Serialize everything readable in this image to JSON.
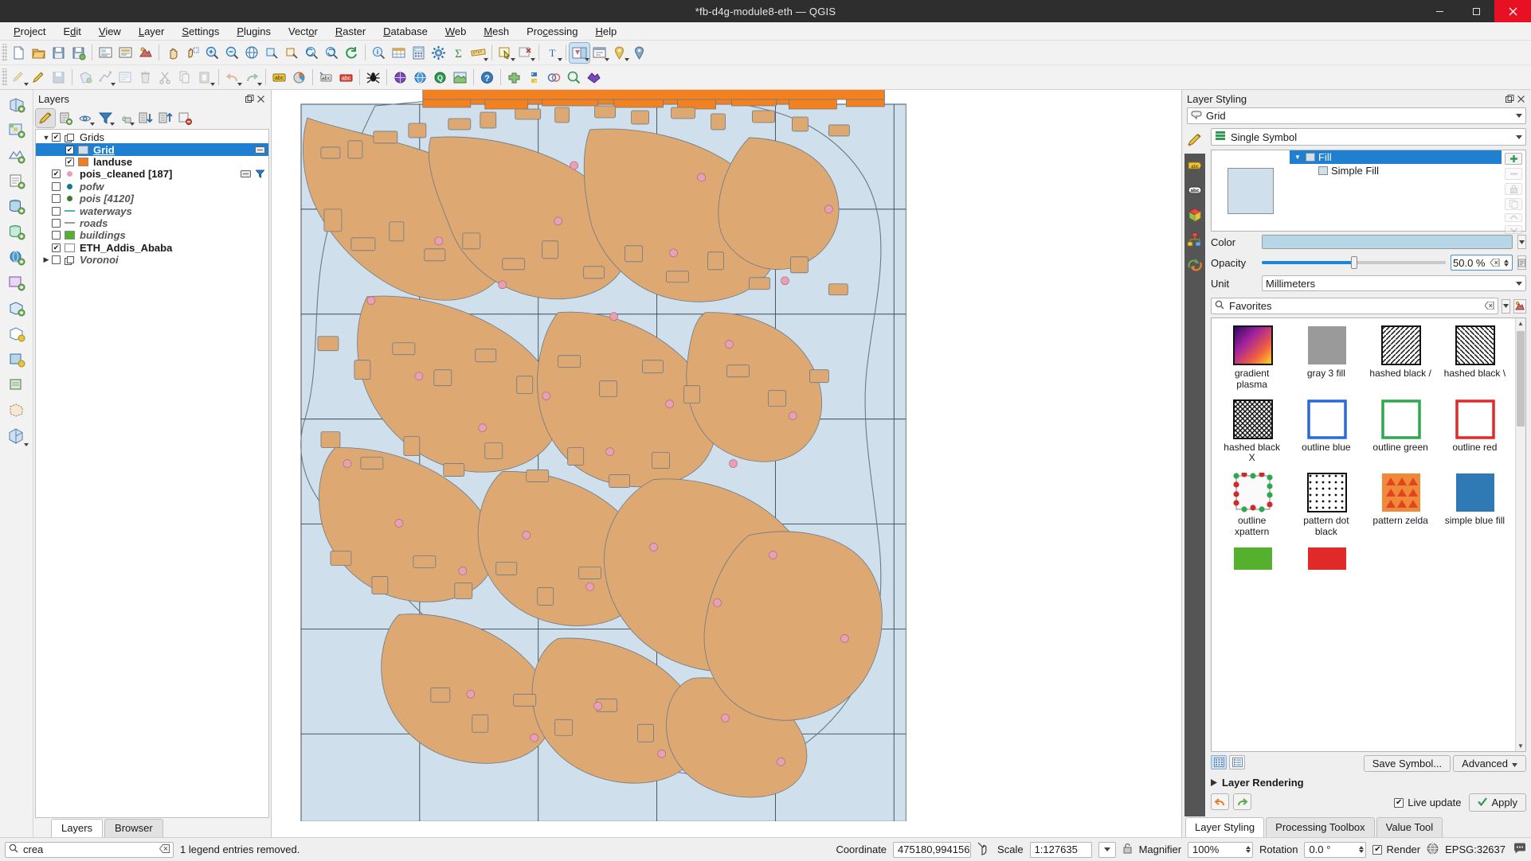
{
  "window": {
    "title": "*fb-d4g-module8-eth — QGIS",
    "minimize": "—",
    "maximize": "▢",
    "close": "✕"
  },
  "menubar": [
    {
      "label": "Project"
    },
    {
      "label": "Edit"
    },
    {
      "label": "View"
    },
    {
      "label": "Layer"
    },
    {
      "label": "Settings"
    },
    {
      "label": "Plugins"
    },
    {
      "label": "Vector"
    },
    {
      "label": "Raster"
    },
    {
      "label": "Database"
    },
    {
      "label": "Web"
    },
    {
      "label": "Mesh"
    },
    {
      "label": "Processing"
    },
    {
      "label": "Help"
    }
  ],
  "layers_panel": {
    "title": "Layers",
    "toolbar": [
      {
        "name": "open-layer-styling-panel",
        "active": true
      },
      {
        "name": "add-group"
      },
      {
        "name": "manage-map-themes"
      },
      {
        "name": "filter-legend"
      },
      {
        "name": "filter-legend-expression"
      },
      {
        "name": "expand-all"
      },
      {
        "name": "collapse-all"
      },
      {
        "name": "remove-layer"
      }
    ],
    "tree": [
      {
        "label": "Grids",
        "type": "group",
        "checked": true,
        "expanded": true,
        "indent": 0,
        "bold": false
      },
      {
        "label": "Grid",
        "type": "fill",
        "checked": true,
        "selected": true,
        "indent": 1,
        "swatch": "#cfe0ec",
        "bold": true
      },
      {
        "label": "landuse",
        "type": "fill",
        "checked": true,
        "indent": 1,
        "swatch": "#f47c20",
        "bold": true
      },
      {
        "label": "pois_cleaned [187]",
        "type": "point",
        "checked": true,
        "indent": 0,
        "dot": "#e8a0b4",
        "bold": true
      },
      {
        "label": "pofw",
        "type": "point",
        "checked": false,
        "indent": 0,
        "dot": "#0d7f82",
        "italic": true
      },
      {
        "label": "pois [4120]",
        "type": "point",
        "checked": false,
        "indent": 0,
        "dot": "#3d7a2e",
        "italic": true
      },
      {
        "label": "waterways",
        "type": "line",
        "checked": false,
        "indent": 0,
        "dash": "#49b5b5",
        "italic": true
      },
      {
        "label": "roads",
        "type": "line",
        "checked": false,
        "indent": 0,
        "dash": "#9a9a9a",
        "italic": true
      },
      {
        "label": "buildings",
        "type": "fill",
        "checked": false,
        "indent": 0,
        "swatch": "#55b02e",
        "italic": true
      },
      {
        "label": "ETH_Addis_Ababa",
        "type": "fill",
        "checked": true,
        "indent": 0,
        "swatch": "#ffffff",
        "bold": true
      },
      {
        "label": "Voronoi",
        "type": "group",
        "checked": false,
        "indent": 0,
        "expandable": true,
        "italic": true
      }
    ],
    "tabs": [
      {
        "label": "Layers",
        "active": true
      },
      {
        "label": "Browser",
        "active": false
      }
    ]
  },
  "styling": {
    "title": "Layer Styling",
    "layer_name": "Grid",
    "renderer": "Single Symbol",
    "symbol_tree": [
      {
        "label": "Fill",
        "level": 0,
        "selected": true
      },
      {
        "label": "Simple Fill",
        "level": 1,
        "selected": false
      }
    ],
    "preview_color": "#cfe0ec",
    "color_label": "Color",
    "color_value": "#b7d6e8",
    "opacity_label": "Opacity",
    "opacity_value": "50.0 %",
    "unit_label": "Unit",
    "unit_value": "Millimeters",
    "search_placeholder": "Favorites",
    "search_value": "Favorites",
    "gallery": [
      {
        "label": "gradient plasma",
        "kind": "gradient"
      },
      {
        "label": "gray 3 fill",
        "kind": "gray"
      },
      {
        "label": "hashed black /",
        "kind": "hatch-fwd"
      },
      {
        "label": "hashed black \\",
        "kind": "hatch-back"
      },
      {
        "label": "hashed black X",
        "kind": "hatch-x"
      },
      {
        "label": "outline blue",
        "kind": "outline-blue"
      },
      {
        "label": "outline green",
        "kind": "outline-green"
      },
      {
        "label": "outline red",
        "kind": "outline-red"
      },
      {
        "label": "outline xpattern",
        "kind": "xpattern"
      },
      {
        "label": "pattern dot black",
        "kind": "dots"
      },
      {
        "label": "pattern zelda",
        "kind": "zelda"
      },
      {
        "label": "simple blue fill",
        "kind": "blue"
      },
      {
        "label": "",
        "kind": "green-partial"
      },
      {
        "label": "",
        "kind": "red-partial"
      }
    ],
    "save_symbol_label": "Save Symbol...",
    "advanced_label": "Advanced",
    "layer_rendering_label": "Layer Rendering",
    "live_update_label": "Live update",
    "apply_label": "Apply",
    "tabs": [
      {
        "label": "Layer Styling",
        "active": true
      },
      {
        "label": "Processing Toolbox",
        "active": false
      },
      {
        "label": "Value Tool",
        "active": false
      }
    ]
  },
  "statusbar": {
    "search_value": "crea",
    "message": "1 legend entries removed.",
    "coordinate_label": "Coordinate",
    "coordinate_value": "475180,994156",
    "scale_label": "Scale",
    "scale_value": "1:127635",
    "magnifier_label": "Magnifier",
    "magnifier_value": "100%",
    "rotation_label": "Rotation",
    "rotation_value": "0.0 °",
    "render_label": "Render",
    "epsg_label": "EPSG:32637"
  }
}
